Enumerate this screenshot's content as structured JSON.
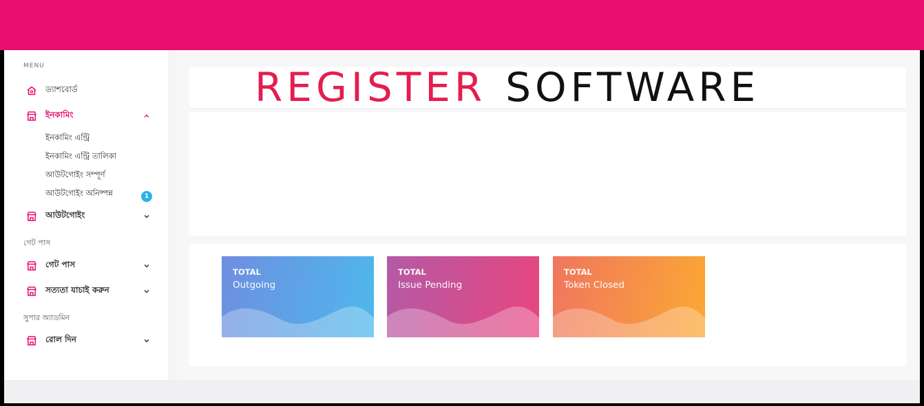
{
  "colors": {
    "brand": "#e80e6f",
    "badge": "#2bb3e8",
    "logo_red": "#e41e4e"
  },
  "sidebar": {
    "menu_title": "MENU",
    "dashboard": {
      "label": "ড্যাশবোর্ড",
      "icon": "home-icon"
    },
    "incoming": {
      "label": "ইনকামিং",
      "icon": "store-icon",
      "expanded": true,
      "children": [
        {
          "label": "ইনকামিং এন্ট্রি"
        },
        {
          "label": "ইনকামিং এন্ট্রি তালিকা"
        },
        {
          "label": "আউটগোইং সম্পূর্ণ"
        },
        {
          "label": "আউটগোইং অনিষ্পন্ন",
          "badge": "1"
        }
      ]
    },
    "outgoing": {
      "label": "আউটগোইং",
      "icon": "store-icon"
    },
    "section_gatepass": "গেট পাস",
    "gatepass": {
      "label": "গেট পাস",
      "icon": "store-icon"
    },
    "verify": {
      "label": "সত্যতা যাচাই করুন",
      "icon": "store-icon"
    },
    "section_superadmin": "সুপার অ্যাডমিন",
    "role": {
      "label": "রোল দিন",
      "icon": "store-icon"
    }
  },
  "logo": {
    "part1": "REGISTER",
    "part2": "SOFTWARE"
  },
  "stats": [
    {
      "line1": "TOTAL",
      "line2": "Outgoing"
    },
    {
      "line1": "TOTAL",
      "line2": "Issue Pending"
    },
    {
      "line1": "TOTAL",
      "line2": "Token Closed"
    }
  ]
}
